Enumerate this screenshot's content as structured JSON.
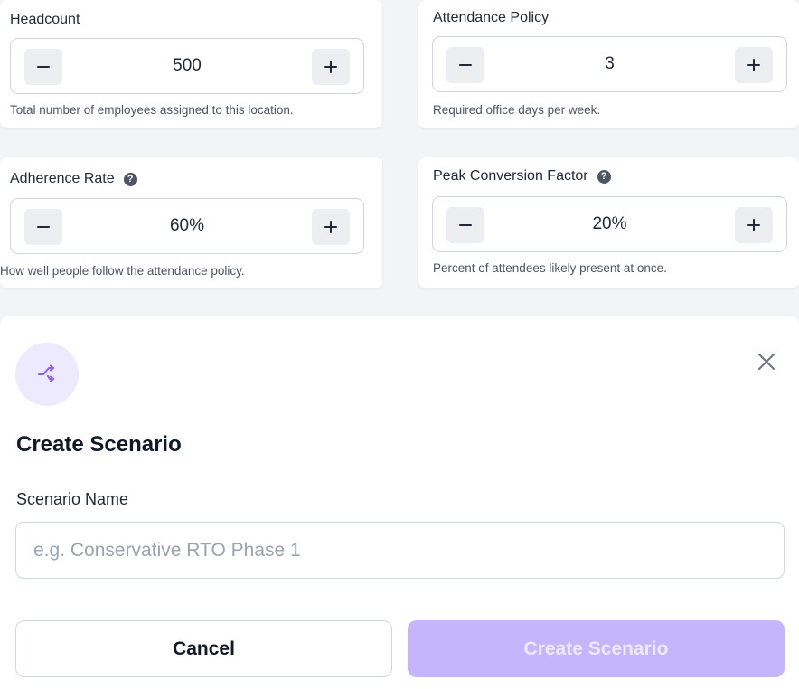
{
  "settings": {
    "headcount": {
      "label": "Headcount",
      "value": "500",
      "hint": "Total number of employees assigned to this location."
    },
    "attendance_policy": {
      "label": "Attendance Policy",
      "value": "3",
      "hint": "Required office days per week."
    },
    "adherence_rate": {
      "label": "Adherence Rate",
      "value": "60%",
      "hint": "How well people follow the attendance policy."
    },
    "peak_conversion": {
      "label": "Peak Conversion Factor",
      "value": "20%",
      "hint": "Percent of attendees likely present at once."
    },
    "help_glyph": "?",
    "decrement_icon": "minus-icon",
    "increment_icon": "plus-icon"
  },
  "dialog": {
    "icon": "shuffle-icon",
    "close_icon": "close-icon",
    "title": "Create Scenario",
    "name_label": "Scenario Name",
    "name_value": "",
    "name_placeholder": "e.g. Conservative RTO Phase 1",
    "cancel_label": "Cancel",
    "create_label": "Create Scenario"
  },
  "colors": {
    "accent": "#8b5cf6",
    "accent_soft": "#ede9fe",
    "create_disabled": "#c4b5fd",
    "text": "#111827",
    "muted": "#4b5563",
    "border": "#d1d5db"
  }
}
